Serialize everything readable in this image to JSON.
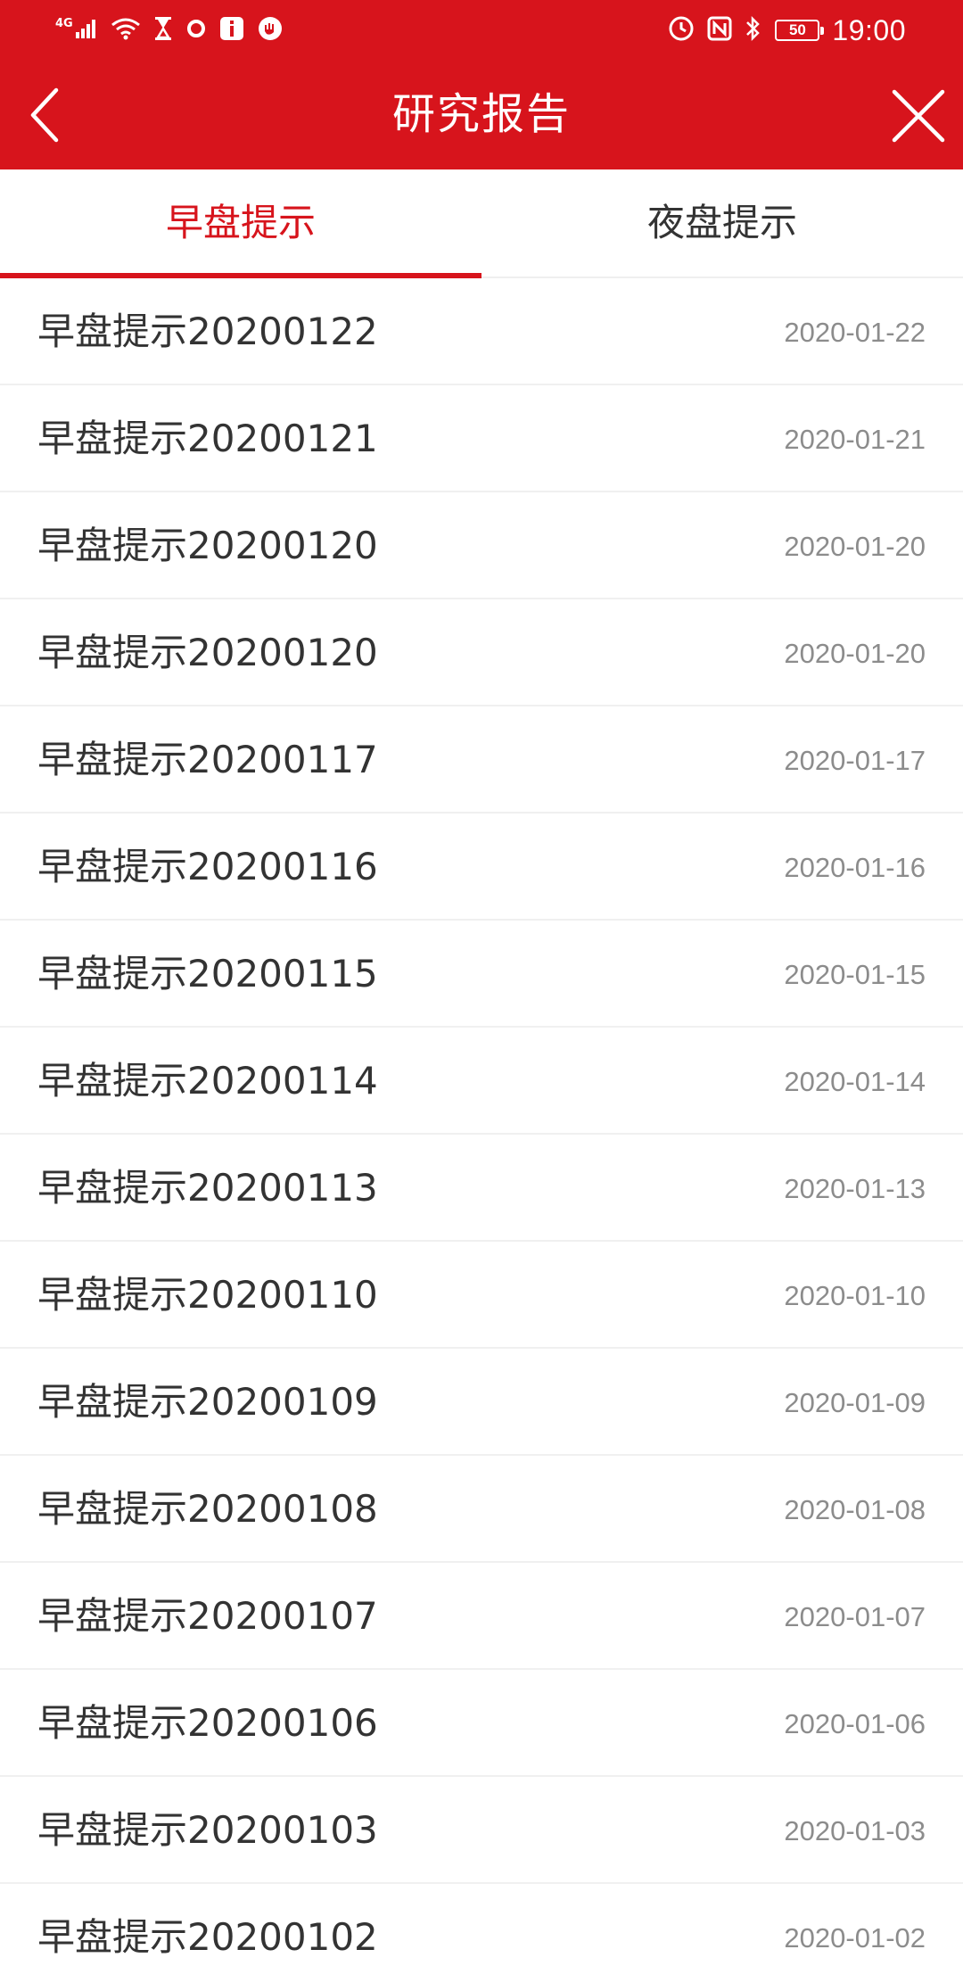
{
  "status_bar": {
    "network": "4G",
    "battery": "50",
    "time": "19:00"
  },
  "header": {
    "title": "研究报告"
  },
  "tabs": [
    {
      "label": "早盘提示",
      "active": true
    },
    {
      "label": "夜盘提示",
      "active": false
    }
  ],
  "reports": [
    {
      "title": "早盘提示20200122",
      "date": "2020-01-22"
    },
    {
      "title": "早盘提示20200121",
      "date": "2020-01-21"
    },
    {
      "title": "早盘提示20200120",
      "date": "2020-01-20"
    },
    {
      "title": "早盘提示20200120",
      "date": "2020-01-20"
    },
    {
      "title": "早盘提示20200117",
      "date": "2020-01-17"
    },
    {
      "title": "早盘提示20200116",
      "date": "2020-01-16"
    },
    {
      "title": "早盘提示20200115",
      "date": "2020-01-15"
    },
    {
      "title": "早盘提示20200114",
      "date": "2020-01-14"
    },
    {
      "title": "早盘提示20200113",
      "date": "2020-01-13"
    },
    {
      "title": "早盘提示20200110",
      "date": "2020-01-10"
    },
    {
      "title": "早盘提示20200109",
      "date": "2020-01-09"
    },
    {
      "title": "早盘提示20200108",
      "date": "2020-01-08"
    },
    {
      "title": "早盘提示20200107",
      "date": "2020-01-07"
    },
    {
      "title": "早盘提示20200106",
      "date": "2020-01-06"
    },
    {
      "title": "早盘提示20200103",
      "date": "2020-01-03"
    },
    {
      "title": "早盘提示20200102",
      "date": "2020-01-02"
    }
  ],
  "colors": {
    "brand_red": "#d7141c",
    "text": "#333333",
    "date_text": "#8c8c8c"
  }
}
